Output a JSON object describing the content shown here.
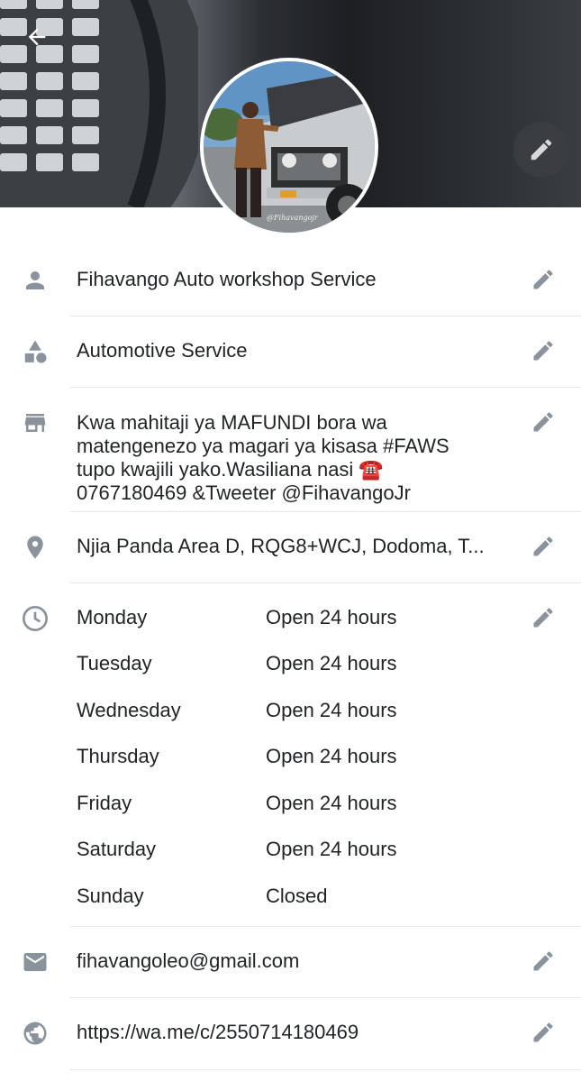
{
  "profile": {
    "name": "Fihavango Auto workshop Service",
    "category": "Automotive Service",
    "description": "Kwa mahitaji ya MAFUNDI bora wa\nmatengenezo ya magari ya kisasa #FAWS\ntupo kwajili yako.Wasiliana nasi ☎️\n0767180469 &Tweeter @FihavangoJr",
    "address": "Njia Panda Area D, RQG8+WCJ, Dodoma, T...",
    "email": "fihavangoleo@gmail.com",
    "website": "https://wa.me/c/2550714180469",
    "photo_watermark": "@Fihavangojr"
  },
  "hours": [
    {
      "day": "Monday",
      "value": "Open 24 hours"
    },
    {
      "day": "Tuesday",
      "value": "Open 24 hours"
    },
    {
      "day": "Wednesday",
      "value": "Open 24 hours"
    },
    {
      "day": "Thursday",
      "value": "Open 24 hours"
    },
    {
      "day": "Friday",
      "value": "Open 24 hours"
    },
    {
      "day": "Saturday",
      "value": "Open 24 hours"
    },
    {
      "day": "Sunday",
      "value": "Closed"
    }
  ],
  "icons": {
    "back": "arrow-left-icon",
    "edit": "pencil-icon",
    "name": "person-icon",
    "category": "shapes-icon",
    "description": "storefront-icon",
    "address": "location-pin-icon",
    "hours": "clock-icon",
    "email": "envelope-icon",
    "website": "globe-icon"
  },
  "colors": {
    "icon": "#8a939b",
    "text": "#1f2326",
    "divider": "#e6e8ea",
    "background": "#ffffff"
  }
}
